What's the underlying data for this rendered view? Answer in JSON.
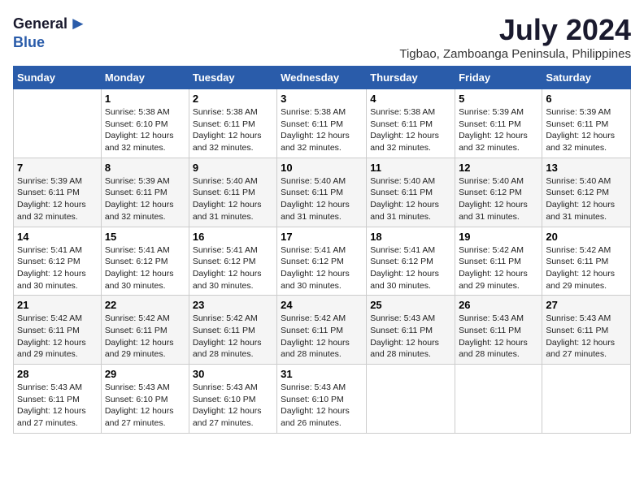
{
  "header": {
    "logo_general": "General",
    "logo_blue": "Blue",
    "title": "July 2024",
    "subtitle": "Tigbao, Zamboanga Peninsula, Philippines"
  },
  "calendar": {
    "days_of_week": [
      "Sunday",
      "Monday",
      "Tuesday",
      "Wednesday",
      "Thursday",
      "Friday",
      "Saturday"
    ],
    "weeks": [
      [
        {
          "day": "",
          "text": ""
        },
        {
          "day": "1",
          "text": "Sunrise: 5:38 AM\nSunset: 6:10 PM\nDaylight: 12 hours\nand 32 minutes."
        },
        {
          "day": "2",
          "text": "Sunrise: 5:38 AM\nSunset: 6:11 PM\nDaylight: 12 hours\nand 32 minutes."
        },
        {
          "day": "3",
          "text": "Sunrise: 5:38 AM\nSunset: 6:11 PM\nDaylight: 12 hours\nand 32 minutes."
        },
        {
          "day": "4",
          "text": "Sunrise: 5:38 AM\nSunset: 6:11 PM\nDaylight: 12 hours\nand 32 minutes."
        },
        {
          "day": "5",
          "text": "Sunrise: 5:39 AM\nSunset: 6:11 PM\nDaylight: 12 hours\nand 32 minutes."
        },
        {
          "day": "6",
          "text": "Sunrise: 5:39 AM\nSunset: 6:11 PM\nDaylight: 12 hours\nand 32 minutes."
        }
      ],
      [
        {
          "day": "7",
          "text": "Sunrise: 5:39 AM\nSunset: 6:11 PM\nDaylight: 12 hours\nand 32 minutes."
        },
        {
          "day": "8",
          "text": "Sunrise: 5:39 AM\nSunset: 6:11 PM\nDaylight: 12 hours\nand 32 minutes."
        },
        {
          "day": "9",
          "text": "Sunrise: 5:40 AM\nSunset: 6:11 PM\nDaylight: 12 hours\nand 31 minutes."
        },
        {
          "day": "10",
          "text": "Sunrise: 5:40 AM\nSunset: 6:11 PM\nDaylight: 12 hours\nand 31 minutes."
        },
        {
          "day": "11",
          "text": "Sunrise: 5:40 AM\nSunset: 6:11 PM\nDaylight: 12 hours\nand 31 minutes."
        },
        {
          "day": "12",
          "text": "Sunrise: 5:40 AM\nSunset: 6:12 PM\nDaylight: 12 hours\nand 31 minutes."
        },
        {
          "day": "13",
          "text": "Sunrise: 5:40 AM\nSunset: 6:12 PM\nDaylight: 12 hours\nand 31 minutes."
        }
      ],
      [
        {
          "day": "14",
          "text": "Sunrise: 5:41 AM\nSunset: 6:12 PM\nDaylight: 12 hours\nand 30 minutes."
        },
        {
          "day": "15",
          "text": "Sunrise: 5:41 AM\nSunset: 6:12 PM\nDaylight: 12 hours\nand 30 minutes."
        },
        {
          "day": "16",
          "text": "Sunrise: 5:41 AM\nSunset: 6:12 PM\nDaylight: 12 hours\nand 30 minutes."
        },
        {
          "day": "17",
          "text": "Sunrise: 5:41 AM\nSunset: 6:12 PM\nDaylight: 12 hours\nand 30 minutes."
        },
        {
          "day": "18",
          "text": "Sunrise: 5:41 AM\nSunset: 6:12 PM\nDaylight: 12 hours\nand 30 minutes."
        },
        {
          "day": "19",
          "text": "Sunrise: 5:42 AM\nSunset: 6:11 PM\nDaylight: 12 hours\nand 29 minutes."
        },
        {
          "day": "20",
          "text": "Sunrise: 5:42 AM\nSunset: 6:11 PM\nDaylight: 12 hours\nand 29 minutes."
        }
      ],
      [
        {
          "day": "21",
          "text": "Sunrise: 5:42 AM\nSunset: 6:11 PM\nDaylight: 12 hours\nand 29 minutes."
        },
        {
          "day": "22",
          "text": "Sunrise: 5:42 AM\nSunset: 6:11 PM\nDaylight: 12 hours\nand 29 minutes."
        },
        {
          "day": "23",
          "text": "Sunrise: 5:42 AM\nSunset: 6:11 PM\nDaylight: 12 hours\nand 28 minutes."
        },
        {
          "day": "24",
          "text": "Sunrise: 5:42 AM\nSunset: 6:11 PM\nDaylight: 12 hours\nand 28 minutes."
        },
        {
          "day": "25",
          "text": "Sunrise: 5:43 AM\nSunset: 6:11 PM\nDaylight: 12 hours\nand 28 minutes."
        },
        {
          "day": "26",
          "text": "Sunrise: 5:43 AM\nSunset: 6:11 PM\nDaylight: 12 hours\nand 28 minutes."
        },
        {
          "day": "27",
          "text": "Sunrise: 5:43 AM\nSunset: 6:11 PM\nDaylight: 12 hours\nand 27 minutes."
        }
      ],
      [
        {
          "day": "28",
          "text": "Sunrise: 5:43 AM\nSunset: 6:11 PM\nDaylight: 12 hours\nand 27 minutes."
        },
        {
          "day": "29",
          "text": "Sunrise: 5:43 AM\nSunset: 6:10 PM\nDaylight: 12 hours\nand 27 minutes."
        },
        {
          "day": "30",
          "text": "Sunrise: 5:43 AM\nSunset: 6:10 PM\nDaylight: 12 hours\nand 27 minutes."
        },
        {
          "day": "31",
          "text": "Sunrise: 5:43 AM\nSunset: 6:10 PM\nDaylight: 12 hours\nand 26 minutes."
        },
        {
          "day": "",
          "text": ""
        },
        {
          "day": "",
          "text": ""
        },
        {
          "day": "",
          "text": ""
        }
      ]
    ]
  }
}
